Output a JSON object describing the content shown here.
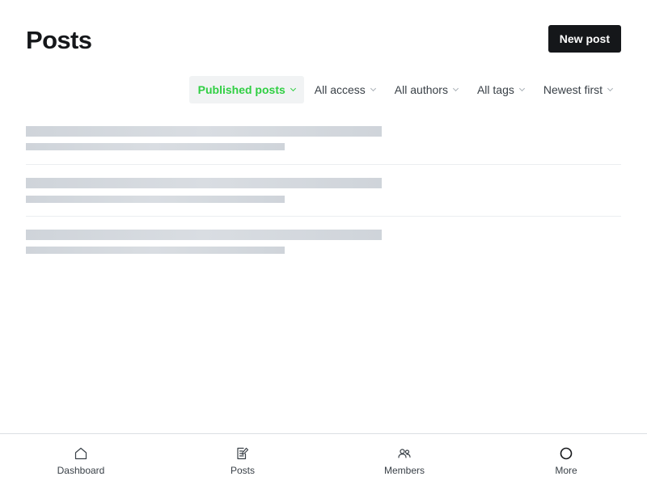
{
  "header": {
    "title": "Posts",
    "new_post_label": "New post"
  },
  "filters": [
    {
      "label": "Published posts",
      "active": true
    },
    {
      "label": "All access",
      "active": false
    },
    {
      "label": "All authors",
      "active": false
    },
    {
      "label": "All tags",
      "active": false
    },
    {
      "label": "Newest first",
      "active": false
    }
  ],
  "list": {
    "state": "loading",
    "placeholder_rows": 3
  },
  "tabbar": {
    "items": [
      {
        "label": "Dashboard",
        "icon": "home-icon"
      },
      {
        "label": "Posts",
        "icon": "edit-icon"
      },
      {
        "label": "Members",
        "icon": "members-icon"
      },
      {
        "label": "More",
        "icon": "circle-icon"
      }
    ]
  },
  "colors": {
    "accent": "#30cf43",
    "primary_button": "#15171a",
    "skeleton": "#cfd4da"
  }
}
